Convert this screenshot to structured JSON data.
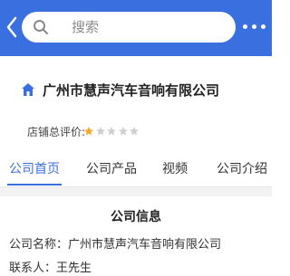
{
  "header": {
    "search_placeholder": "搜索",
    "background_color": "#3a6fe0",
    "icons": [
      "back-icon",
      "search-icon",
      "more-icon"
    ]
  },
  "shop": {
    "name": "广州市慧声汽车音响有限公司",
    "rating_label": "店铺总评价:",
    "rating_stars_filled": 1,
    "rating_stars_total": 5,
    "icon": "home-icon"
  },
  "tabs": [
    {
      "label": "公司首页",
      "active": true
    },
    {
      "label": "公司产品",
      "active": false
    },
    {
      "label": "视频",
      "active": false
    },
    {
      "label": "公司介绍",
      "active": false
    }
  ],
  "company_info": {
    "title": "公司信息",
    "rows": [
      {
        "label": "公司名称：",
        "value": "广州市慧声汽车音响有限公司"
      },
      {
        "label": "联系人：",
        "value": "王先生"
      }
    ]
  },
  "colors": {
    "accent": "#3a6fe0",
    "star_filled": "#f5a623",
    "star_empty": "#cfcfcf"
  }
}
